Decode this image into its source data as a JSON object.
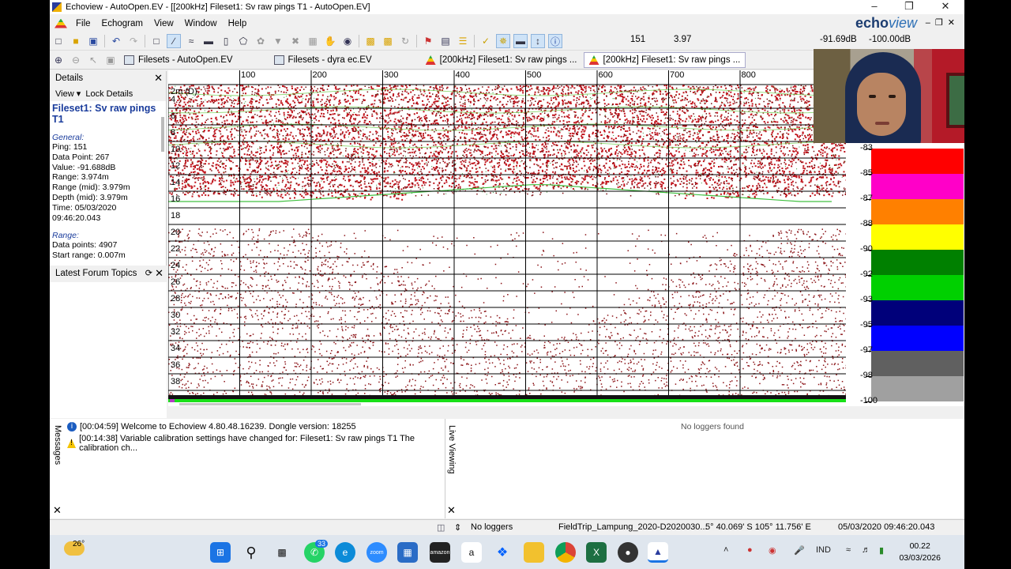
{
  "window": {
    "title": "Echoview - AutoOpen.EV - [[200kHz] Fileset1: Sv raw pings T1 - AutoOpen.EV]",
    "brand_a": "echo",
    "brand_b": "view"
  },
  "menu": [
    "File",
    "Echogram",
    "View",
    "Window",
    "Help"
  ],
  "toolbar_readout": {
    "ping": "151",
    "range": "3.97",
    "value": "-91.69dB",
    "threshold": "-100.00dB"
  },
  "tabs": [
    {
      "label": "Filesets - AutoOpen.EV",
      "icon": "fileset-icon",
      "active": false
    },
    {
      "label": "Filesets - dyra ec.EV",
      "icon": "fileset-icon",
      "active": false
    },
    {
      "label": "[200kHz] Fileset1: Sv raw pings ...",
      "icon": "echogram-icon",
      "active": false
    },
    {
      "label": "[200kHz] Fileset1: Sv raw pings ...",
      "icon": "echogram-icon",
      "active": true
    }
  ],
  "details": {
    "header": "Details",
    "view_label": "View",
    "lock_label": "Lock Details",
    "fileset": "Fileset1: Sv raw pings T1",
    "general_header": "General:",
    "general": [
      "Ping: 151",
      "Data Point: 267",
      "Value: -91.688dB",
      "Range: 3.974m",
      "Range (mid): 3.979m",
      "Depth (mid): 3.979m",
      "Time: 05/03/2020",
      "09:46:20.043"
    ],
    "range_header": "Range:",
    "range": [
      "Data points: 4907",
      "Start range: 0.007m"
    ]
  },
  "forum": {
    "header": "Latest Forum Topics"
  },
  "echogram": {
    "x_ticks": [
      "100",
      "200",
      "300",
      "400",
      "500",
      "600",
      "700",
      "800"
    ],
    "y_ticks": [
      "4",
      "6",
      "8",
      "10",
      "12",
      "14",
      "16",
      "18",
      "20",
      "22",
      "24",
      "26",
      "28",
      "30",
      "32",
      "34",
      "36",
      "38"
    ],
    "range_badge": "2m (D)"
  },
  "color_scale": {
    "labels": [
      "-83",
      "-85",
      "-87",
      "-88",
      "-90",
      "-92",
      "-93",
      "-95",
      "-97",
      "-98",
      "-100"
    ],
    "colors": [
      "#ff0000",
      "#ff00c8",
      "#ff8000",
      "#ffff00",
      "#008000",
      "#00d000",
      "#00007a",
      "#0000ff",
      "#606060",
      "#a0a0a0"
    ]
  },
  "messages": [
    {
      "icon": "info-icon",
      "text": "[00:04:59] Welcome to Echoview 4.80.48.16239. Dongle version: 18255"
    },
    {
      "icon": "warning-icon",
      "text": "[00:14:38] Variable calibration settings have changed for: Fileset1: Sv raw pings T1  The calibration ch..."
    }
  ],
  "messages_label": "Messages",
  "live_viewing_label": "Live Viewing",
  "no_loggers_found": "No loggers found",
  "status": {
    "loggers": "No loggers",
    "file": "FieldTrip_Lampung_2020-D2020030...",
    "position": "5° 40.069' S 105° 11.756' E",
    "datetime": "05/03/2020 09:46:20.043"
  },
  "taskbar": {
    "temperature": "26°",
    "whatsapp_badge": "33",
    "language": "IND",
    "time": "00.22",
    "date": "03/03/2026"
  }
}
